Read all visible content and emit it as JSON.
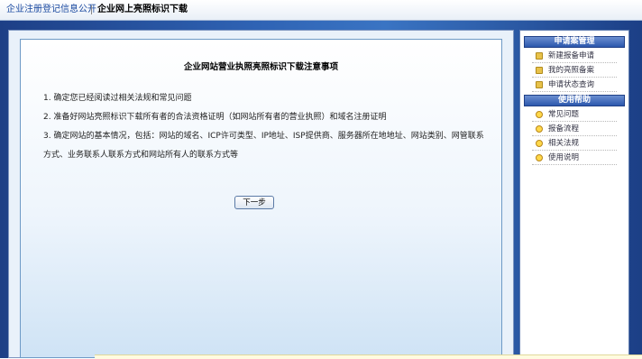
{
  "tabs": [
    {
      "label": "企业注册登记信息公开",
      "active": false
    },
    {
      "label": "企业网上亮照标识下载",
      "active": true
    }
  ],
  "main": {
    "title": "企业网站营业执照亮照标识下载注意事项",
    "steps": [
      "1. 确定您已经阅读过相关法规和常见问题",
      "2. 准备好网站亮照标识下载所有者的合法资格证明（如网站所有者的营业执照）和域名注册证明",
      "3. 确定网站的基本情况，包括：网站的域名、ICP许可类型、IP地址、ISP提供商、服务器所在地地址、网站类别、网管联系方式、业务联系人联系方式和网站所有人的联系方式等"
    ],
    "next_button": "下一步"
  },
  "sidebar": {
    "section1": {
      "header": "申请案管理",
      "items": [
        {
          "label": "新建报备申请",
          "icon": "folder-icon"
        },
        {
          "label": "我的亮照备案",
          "icon": "folder-icon"
        },
        {
          "label": "申请状态查询",
          "icon": "folder-icon"
        }
      ]
    },
    "section2": {
      "header": "使用帮助",
      "items": [
        {
          "label": "常见问题",
          "icon": "help-icon"
        },
        {
          "label": "报备流程",
          "icon": "help-icon"
        },
        {
          "label": "相关法规",
          "icon": "help-icon"
        },
        {
          "label": "使用说明",
          "icon": "help-icon"
        }
      ]
    }
  },
  "colors": {
    "background_blue": "#2f63b4",
    "tab_link": "#1b4aa0",
    "sidebar_header": "#2c58ad"
  }
}
